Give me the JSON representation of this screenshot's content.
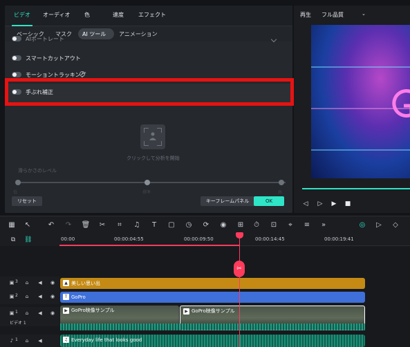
{
  "panel": {
    "tabs": [
      "ビデオ",
      "オーディオ",
      "色",
      "速度",
      "エフェクト"
    ],
    "subtabs": [
      "ベーシック",
      "マスク",
      "AI ツール",
      "アニメーション"
    ],
    "rows": [
      {
        "label": "AIポートレート",
        "enabled": false
      },
      {
        "label": "スマートカットアウト",
        "enabled": false
      },
      {
        "label": "モーショントラッキング",
        "enabled": false
      },
      {
        "label": "手ぶれ補正",
        "enabled": false
      }
    ],
    "analyze_text": "クリックして分析を開始",
    "smoothness_label": "滑らかさのレベル",
    "slider_ticks": [
      "低",
      "標準",
      "高"
    ],
    "reset_button": "リセット",
    "keyframe_button": "キーフレームパネル",
    "ok_button": "OK"
  },
  "preview": {
    "label": "再生",
    "quality": "フル品質",
    "quality_icon": "chevron-down-icon",
    "controls": [
      "prev-frame-icon",
      "next-frame-icon",
      "play-icon",
      "stop-icon"
    ]
  },
  "timeline": {
    "ruler": [
      "00:00",
      "00:00:04:55",
      "00:00:09:50",
      "00:00:14:45",
      "00:00:19:41"
    ],
    "tracks": [
      {
        "num": "3",
        "clip": "美しい思い出",
        "color": "#c48a14"
      },
      {
        "num": "2",
        "clip": "GoPro",
        "color": "#3f6fd8"
      },
      {
        "num": "1",
        "name": "ビデオ 1",
        "clips": [
          "GoPro映像サンプル",
          "GoPro映像サンプル"
        ]
      },
      {
        "num": "1",
        "clip": "Everyday life that looks good"
      }
    ]
  },
  "colors": {
    "accent": "#2ee5c7",
    "highlight": "#e81212",
    "playhead": "#ff3b5c"
  }
}
